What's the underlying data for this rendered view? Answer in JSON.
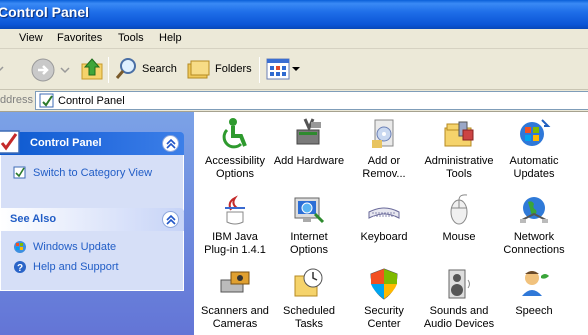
{
  "window": {
    "title": "Control Panel"
  },
  "menu": {
    "items": [
      "t",
      "View",
      "Favorites",
      "Tools",
      "Help"
    ]
  },
  "toolbar": {
    "search_label": "Search",
    "folders_label": "Folders"
  },
  "address": {
    "label": "ddress",
    "value": "Control Panel"
  },
  "sidebar": {
    "panel1": {
      "title": "Control Panel",
      "links": [
        "Switch to Category View"
      ]
    },
    "panel2": {
      "title": "See Also",
      "links": [
        "Windows Update",
        "Help and Support"
      ]
    }
  },
  "items": [
    {
      "label": "Accessibility\nOptions",
      "icon": "accessibility-icon"
    },
    {
      "label": "Add Hardware",
      "icon": "add-hardware-icon"
    },
    {
      "label": "Add or\nRemov...",
      "icon": "add-remove-programs-icon"
    },
    {
      "label": "Administrative\nTools",
      "icon": "administrative-tools-icon"
    },
    {
      "label": "Automatic\nUpdates",
      "icon": "automatic-updates-icon"
    },
    {
      "label": "IBM Java\nPlug-in 1.4.1",
      "icon": "java-icon"
    },
    {
      "label": "Internet\nOptions",
      "icon": "internet-options-icon"
    },
    {
      "label": "Keyboard",
      "icon": "keyboard-icon"
    },
    {
      "label": "Mouse",
      "icon": "mouse-icon"
    },
    {
      "label": "Network\nConnections",
      "icon": "network-connections-icon"
    },
    {
      "label": "Scanners and\nCameras",
      "icon": "scanner-camera-icon"
    },
    {
      "label": "Scheduled\nTasks",
      "icon": "scheduled-tasks-icon"
    },
    {
      "label": "Security\nCenter",
      "icon": "security-center-icon"
    },
    {
      "label": "Sounds and\nAudio Devices",
      "icon": "sounds-icon"
    },
    {
      "label": "Speech",
      "icon": "speech-icon"
    }
  ]
}
